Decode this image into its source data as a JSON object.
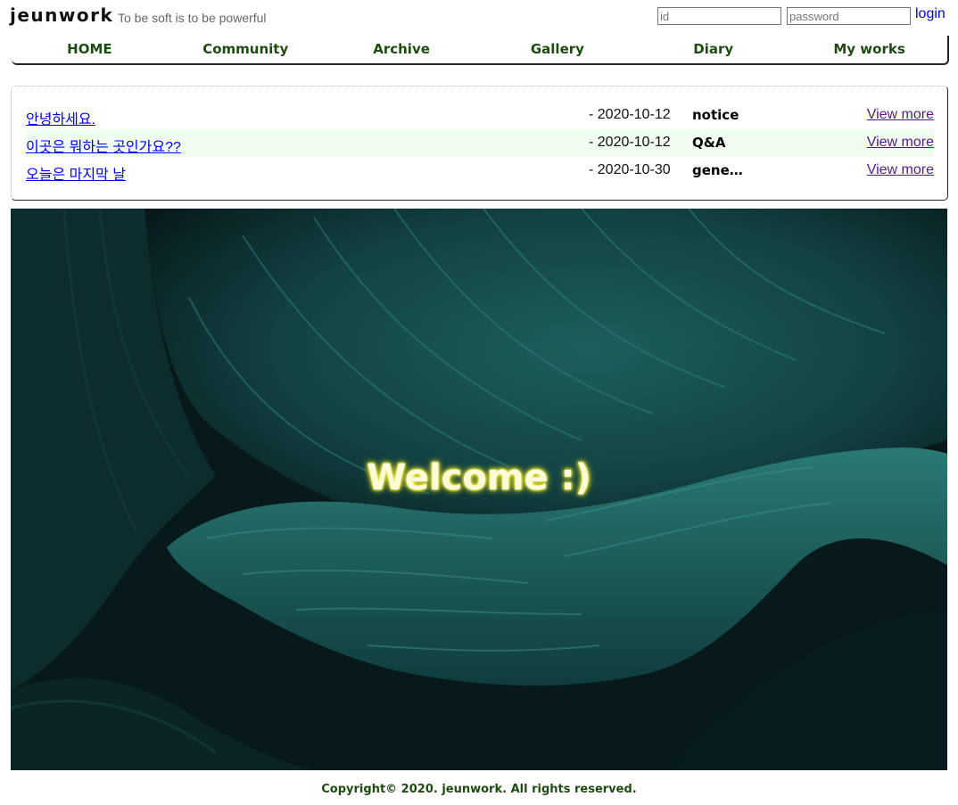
{
  "header": {
    "logo": "jeunwork",
    "slogan": "To be soft is to be powerful",
    "login": {
      "id_placeholder": "id",
      "password_placeholder": "password",
      "login_label": "login"
    }
  },
  "nav": {
    "items": [
      {
        "label": "HOME"
      },
      {
        "label": "Community"
      },
      {
        "label": "Archive"
      },
      {
        "label": "Gallery"
      },
      {
        "label": "Diary"
      },
      {
        "label": "My works"
      }
    ]
  },
  "board": {
    "posts": [
      {
        "title": "안녕하세요.",
        "date": "- 2020-10-12",
        "category": "notice",
        "more": "View more"
      },
      {
        "title": "이곳은 뭐하는 곳인가요??",
        "date": "- 2020-10-12",
        "category": "Q&A",
        "more": "View more"
      },
      {
        "title": "오늘은 마지막 날",
        "date": "- 2020-10-30",
        "category": "general",
        "more": "View more"
      }
    ]
  },
  "hero": {
    "welcome": "Welcome :)"
  },
  "footer": {
    "copyright": "Copyright© 2020. jeunwork. All rights reserved."
  },
  "colors": {
    "nav_text": "#1e4b12",
    "link": "#0000ee",
    "visited_link": "#551a8b",
    "alt_row_bg": "#f0fcf0",
    "hero_bg": "#07171a",
    "welcome_glow": "#e8e640"
  }
}
